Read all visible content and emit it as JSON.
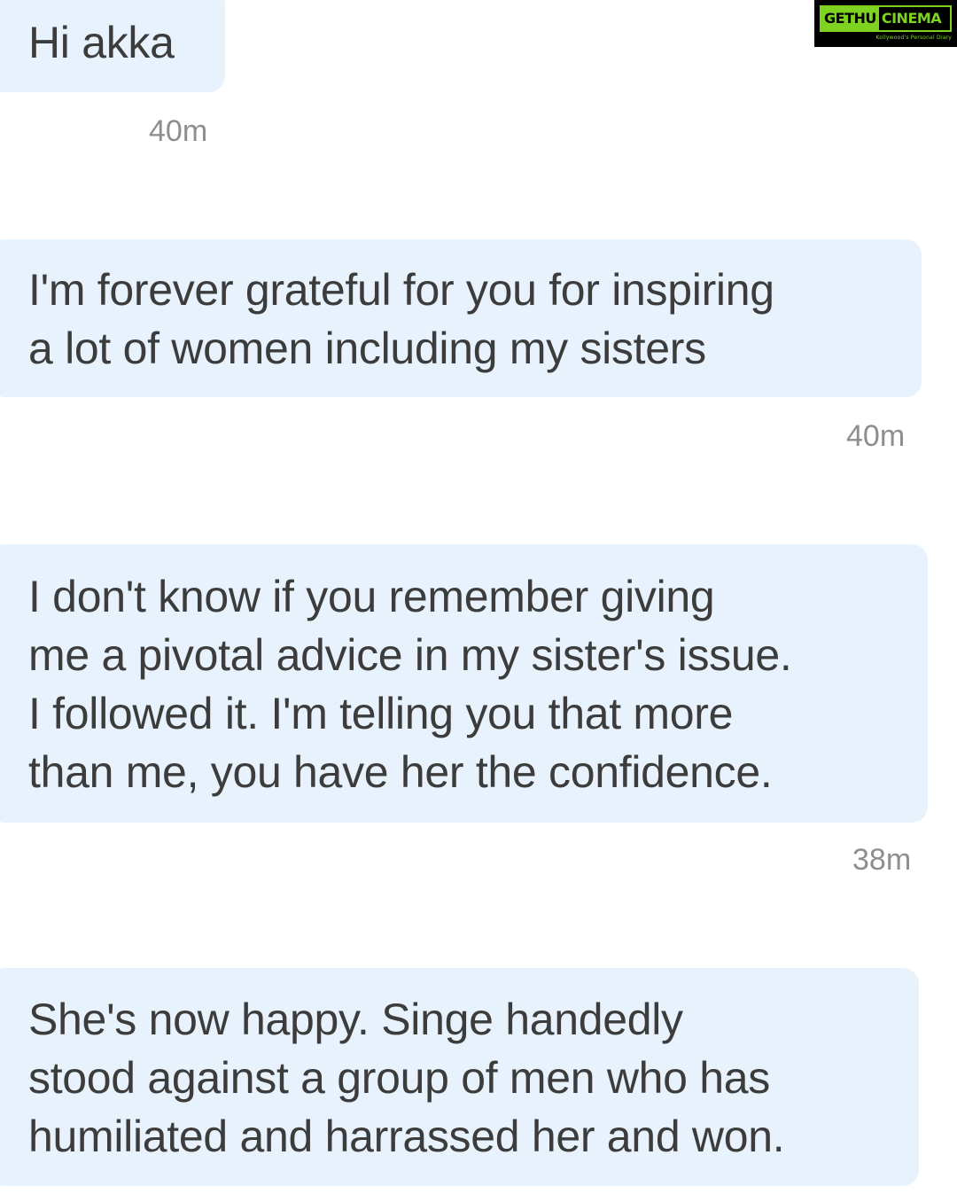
{
  "watermark": {
    "word_a": "GETHU",
    "word_b": "CINEMA",
    "tagline": "Kollywood's Personal Diary",
    "accent_color": "#7ed321"
  },
  "messages": [
    {
      "lines": [
        "Hi akka"
      ],
      "timestamp": "40m"
    },
    {
      "lines": [
        "I'm forever grateful for you for inspiring",
        "a lot of women including my sisters"
      ],
      "timestamp": "40m"
    },
    {
      "lines": [
        "I don't know if you remember giving",
        "me a pivotal advice in my sister's issue.",
        "I followed it. I'm telling you that more",
        "than me, you have her the confidence."
      ],
      "timestamp": "38m"
    },
    {
      "lines": [
        "She's now happy. Singe handedly",
        "stood against a group of men who has",
        "humiliated and harrassed her and won."
      ]
    }
  ],
  "colors": {
    "bubble_background": "#e8f2fc",
    "message_text": "#3c3c3c",
    "timestamp_text": "#8e8e8e"
  }
}
